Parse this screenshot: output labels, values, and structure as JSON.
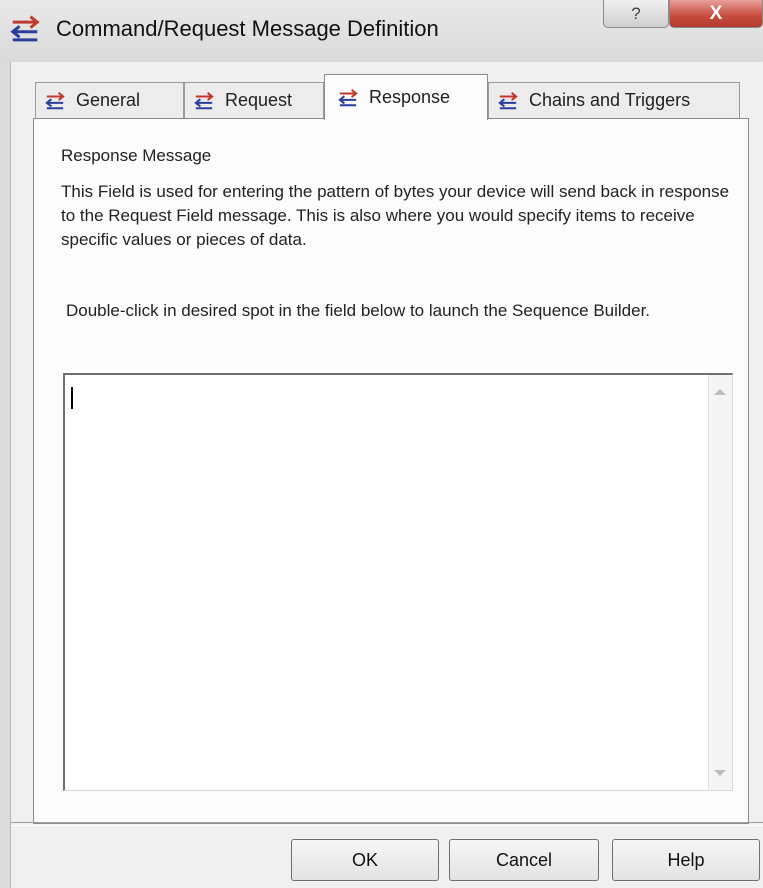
{
  "window": {
    "title": "Command/Request Message Definition",
    "help_glyph": "?",
    "close_glyph": "X"
  },
  "tabs": [
    {
      "label": "General",
      "icon": "arrows-icon",
      "active": false
    },
    {
      "label": "Request",
      "icon": "arrows-icon",
      "active": false
    },
    {
      "label": "Response",
      "icon": "arrows-icon",
      "active": true
    },
    {
      "label": "Chains and Triggers",
      "icon": "arrows-icon",
      "active": false
    }
  ],
  "panel": {
    "heading": "Response Message",
    "description": "This Field is used for entering the pattern of bytes your device will send back in response to the Request Field message.  This is also where you would specify items to receive specific values or pieces of data.",
    "instruction": "Double-click in desired spot in the field below to launch the Sequence Builder.",
    "field_value": ""
  },
  "buttons": {
    "ok": "OK",
    "cancel": "Cancel",
    "help": "Help"
  },
  "colors": {
    "arrow_red": "#c0392b",
    "arrow_blue": "#2a3f9d",
    "close_red": "#c64a3c"
  }
}
